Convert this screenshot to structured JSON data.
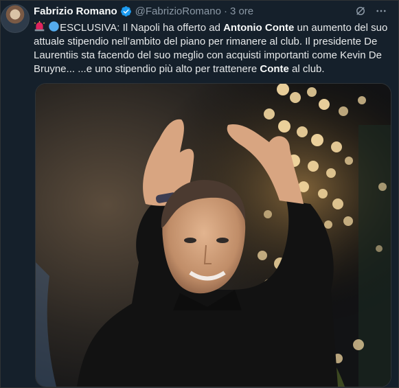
{
  "tweet": {
    "author_name": "Fabrizio Romano",
    "handle": "@FabrizioRomano",
    "separator": "·",
    "time": "3 ore",
    "text_parts": [
      "ESCLUSIVA: Il Napoli ha offerto ad ",
      "Antonio Conte",
      " un aumento del suo attuale stipendio nell’ambito del piano per rimanere al club. Il presidente De Laurentiis sta facendo del suo meglio con acquisti importanti come Kevin De Bruyne... ...e uno stipendio più alto per trattenere ",
      "Conte",
      " al club."
    ],
    "emoji_icons": [
      "siren-icon",
      "blue-circle-icon"
    ]
  },
  "colors": {
    "background": "#15202b",
    "verified": "#1d9bf0",
    "muted": "#8b98a5"
  },
  "media": {
    "alt_icon": "photo-of-man-applauding"
  }
}
